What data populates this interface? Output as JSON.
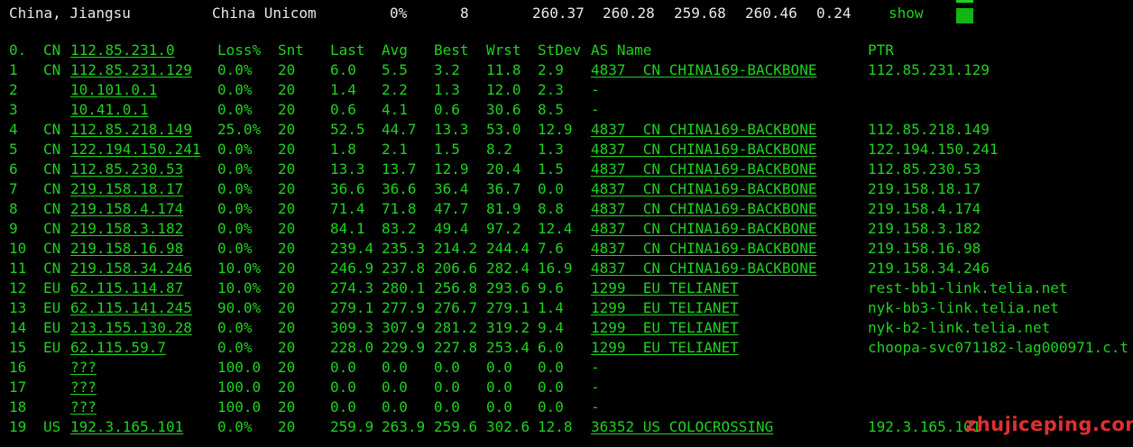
{
  "summary": {
    "location": "China, Jiangsu",
    "isp": "China Unicom",
    "loss": "0%",
    "sent": "8",
    "last": "260.37",
    "avg": "260.28",
    "best": "259.68",
    "worst": "260.46",
    "stdev": "0.24",
    "show_label": "show"
  },
  "headers": {
    "idx": "0.",
    "cc": "CN",
    "host": "112.85.231.0",
    "loss": "Loss%",
    "snt": "Snt",
    "last": "Last",
    "avg": "Avg",
    "best": "Best",
    "wrst": "Wrst",
    "stdev": "StDev",
    "as": "AS Name",
    "ptr": "PTR"
  },
  "hops": [
    {
      "idx": "1",
      "cc": "CN",
      "host": "112.85.231.129",
      "loss": "0.0%",
      "snt": "20",
      "last": "6.0",
      "avg": "5.5",
      "best": "3.2",
      "wrst": "11.8",
      "stdev": "2.9",
      "as": "4837  CN CHINA169-BACKBONE",
      "ptr": "112.85.231.129"
    },
    {
      "idx": "2",
      "cc": "",
      "host": "10.101.0.1",
      "loss": "0.0%",
      "snt": "20",
      "last": "1.4",
      "avg": "2.2",
      "best": "1.3",
      "wrst": "12.0",
      "stdev": "2.3",
      "as": "-",
      "ptr": ""
    },
    {
      "idx": "3",
      "cc": "",
      "host": "10.41.0.1",
      "loss": "0.0%",
      "snt": "20",
      "last": "0.6",
      "avg": "4.1",
      "best": "0.6",
      "wrst": "30.6",
      "stdev": "8.5",
      "as": "-",
      "ptr": ""
    },
    {
      "idx": "4",
      "cc": "CN",
      "host": "112.85.218.149",
      "loss": "25.0%",
      "snt": "20",
      "last": "52.5",
      "avg": "44.7",
      "best": "13.3",
      "wrst": "53.0",
      "stdev": "12.9",
      "as": "4837  CN CHINA169-BACKBONE",
      "ptr": "112.85.218.149"
    },
    {
      "idx": "5",
      "cc": "CN",
      "host": "122.194.150.241",
      "loss": "0.0%",
      "snt": "20",
      "last": "1.8",
      "avg": "2.1",
      "best": "1.5",
      "wrst": "8.2",
      "stdev": "1.3",
      "as": "4837  CN CHINA169-BACKBONE",
      "ptr": "122.194.150.241"
    },
    {
      "idx": "6",
      "cc": "CN",
      "host": "112.85.230.53",
      "loss": "0.0%",
      "snt": "20",
      "last": "13.3",
      "avg": "13.7",
      "best": "12.9",
      "wrst": "20.4",
      "stdev": "1.5",
      "as": "4837  CN CHINA169-BACKBONE",
      "ptr": "112.85.230.53"
    },
    {
      "idx": "7",
      "cc": "CN",
      "host": "219.158.18.17",
      "loss": "0.0%",
      "snt": "20",
      "last": "36.6",
      "avg": "36.6",
      "best": "36.4",
      "wrst": "36.7",
      "stdev": "0.0",
      "as": "4837  CN CHINA169-BACKBONE",
      "ptr": "219.158.18.17"
    },
    {
      "idx": "8",
      "cc": "CN",
      "host": "219.158.4.174",
      "loss": "0.0%",
      "snt": "20",
      "last": "71.4",
      "avg": "71.8",
      "best": "47.7",
      "wrst": "81.9",
      "stdev": "8.8",
      "as": "4837  CN CHINA169-BACKBONE",
      "ptr": "219.158.4.174"
    },
    {
      "idx": "9",
      "cc": "CN",
      "host": "219.158.3.182",
      "loss": "0.0%",
      "snt": "20",
      "last": "84.1",
      "avg": "83.2",
      "best": "49.4",
      "wrst": "97.2",
      "stdev": "12.4",
      "as": "4837  CN CHINA169-BACKBONE",
      "ptr": "219.158.3.182"
    },
    {
      "idx": "10",
      "cc": "CN",
      "host": "219.158.16.98",
      "loss": "0.0%",
      "snt": "20",
      "last": "239.4",
      "avg": "235.3",
      "best": "214.2",
      "wrst": "244.4",
      "stdev": "7.6",
      "as": "4837  CN CHINA169-BACKBONE",
      "ptr": "219.158.16.98"
    },
    {
      "idx": "11",
      "cc": "CN",
      "host": "219.158.34.246",
      "loss": "10.0%",
      "snt": "20",
      "last": "246.9",
      "avg": "237.8",
      "best": "206.6",
      "wrst": "282.4",
      "stdev": "16.9",
      "as": "4837  CN CHINA169-BACKBONE",
      "ptr": "219.158.34.246"
    },
    {
      "idx": "12",
      "cc": "EU",
      "host": "62.115.114.87",
      "loss": "10.0%",
      "snt": "20",
      "last": "274.3",
      "avg": "280.1",
      "best": "256.8",
      "wrst": "293.6",
      "stdev": "9.6",
      "as": "1299  EU TELIANET",
      "ptr": "rest-bb1-link.telia.net"
    },
    {
      "idx": "13",
      "cc": "EU",
      "host": "62.115.141.245",
      "loss": "90.0%",
      "snt": "20",
      "last": "279.1",
      "avg": "277.9",
      "best": "276.7",
      "wrst": "279.1",
      "stdev": "1.4",
      "as": "1299  EU TELIANET",
      "ptr": "nyk-bb3-link.telia.net"
    },
    {
      "idx": "14",
      "cc": "EU",
      "host": "213.155.130.28",
      "loss": "0.0%",
      "snt": "20",
      "last": "309.3",
      "avg": "307.9",
      "best": "281.2",
      "wrst": "319.2",
      "stdev": "9.4",
      "as": "1299  EU TELIANET",
      "ptr": "nyk-b2-link.telia.net"
    },
    {
      "idx": "15",
      "cc": "EU",
      "host": "62.115.59.7",
      "loss": "0.0%",
      "snt": "20",
      "last": "228.0",
      "avg": "229.9",
      "best": "227.8",
      "wrst": "253.4",
      "stdev": "6.0",
      "as": "1299  EU TELIANET",
      "ptr": "choopa-svc071182-lag000971.c.t"
    },
    {
      "idx": "16",
      "cc": "",
      "host": "???",
      "loss": "100.0",
      "snt": "20",
      "last": "0.0",
      "avg": "0.0",
      "best": "0.0",
      "wrst": "0.0",
      "stdev": "0.0",
      "as": "-",
      "ptr": ""
    },
    {
      "idx": "17",
      "cc": "",
      "host": "???",
      "loss": "100.0",
      "snt": "20",
      "last": "0.0",
      "avg": "0.0",
      "best": "0.0",
      "wrst": "0.0",
      "stdev": "0.0",
      "as": "-",
      "ptr": ""
    },
    {
      "idx": "18",
      "cc": "",
      "host": "???",
      "loss": "100.0",
      "snt": "20",
      "last": "0.0",
      "avg": "0.0",
      "best": "0.0",
      "wrst": "0.0",
      "stdev": "0.0",
      "as": "-",
      "ptr": ""
    },
    {
      "idx": "19",
      "cc": "US",
      "host": "192.3.165.101",
      "loss": "0.0%",
      "snt": "20",
      "last": "259.9",
      "avg": "263.9",
      "best": "259.6",
      "wrst": "302.6",
      "stdev": "12.8",
      "as": "36352 US COLOCROSSING",
      "ptr": "192.3.165.101"
    }
  ],
  "watermark": "zhujiceping.com",
  "colors": {
    "background": "#000000",
    "text_green": "#1fd21f",
    "text_white": "#e8e8e8",
    "watermark_red": "#e03030"
  }
}
